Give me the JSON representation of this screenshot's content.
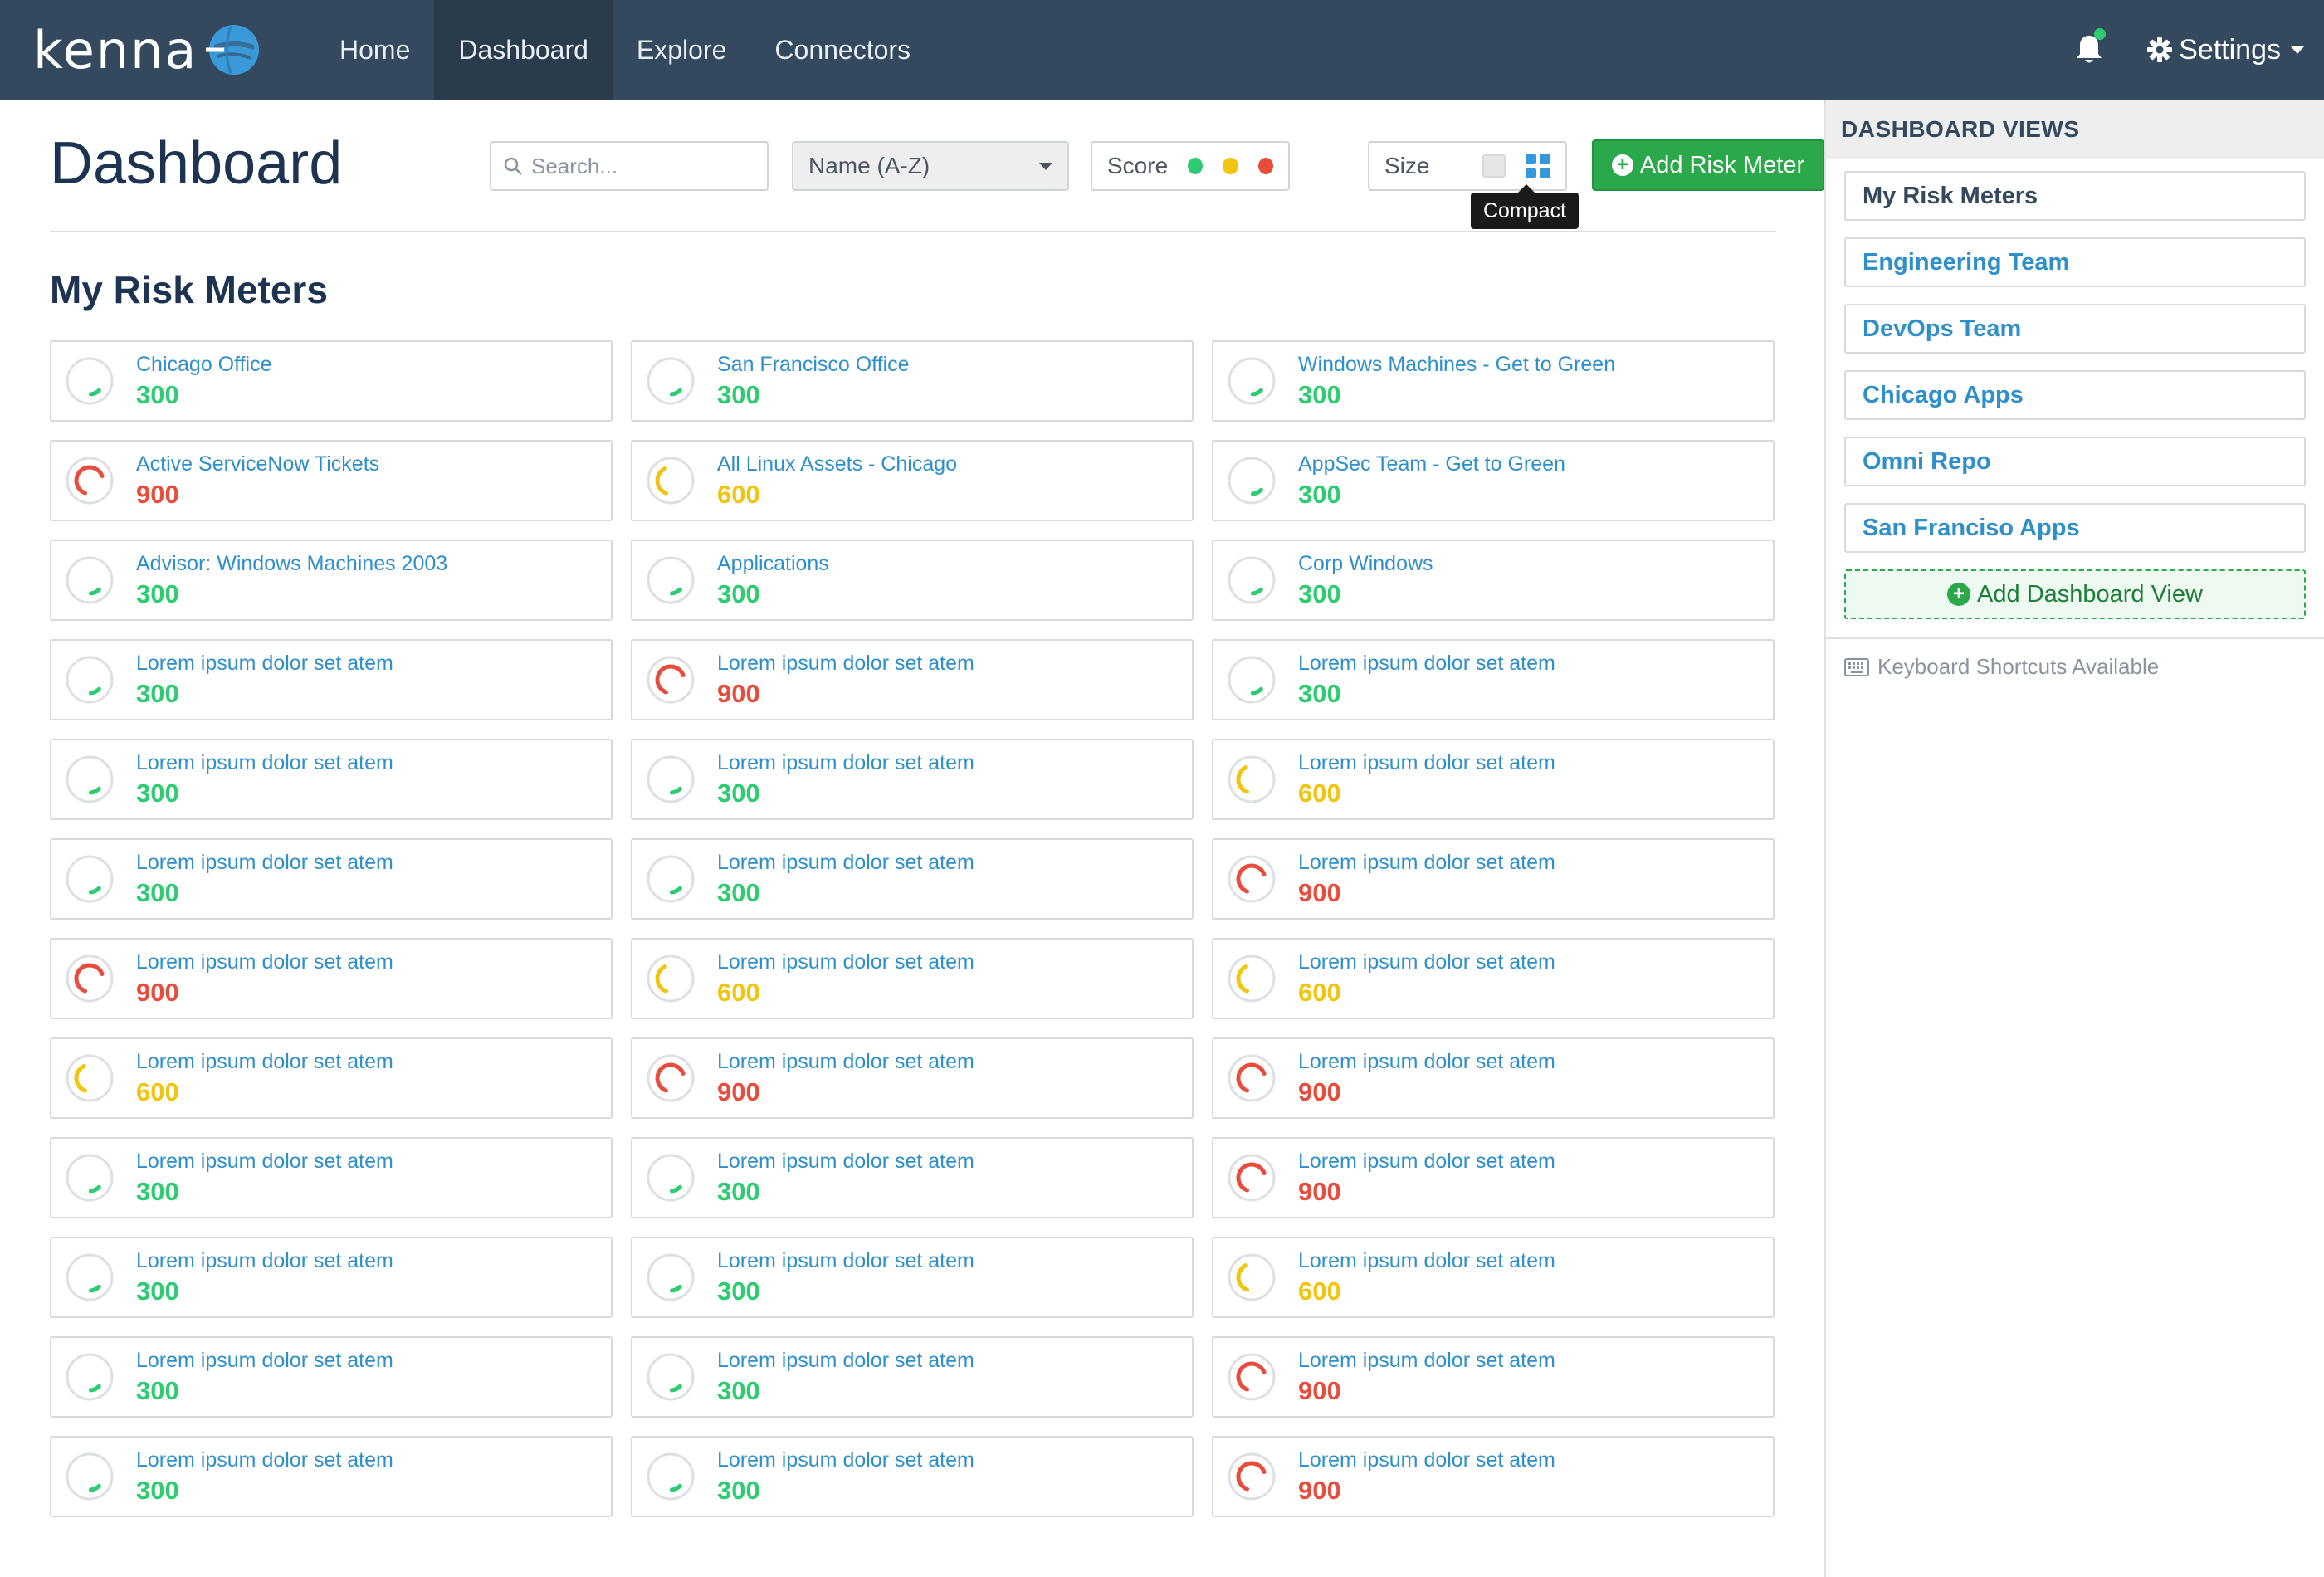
{
  "nav": {
    "logo_text": "kenna",
    "items": [
      {
        "label": "Home",
        "active": false
      },
      {
        "label": "Dashboard",
        "active": true
      },
      {
        "label": "Explore",
        "active": false
      },
      {
        "label": "Connectors",
        "active": false
      }
    ],
    "settings_label": "Settings",
    "notification_icon": "bell-icon",
    "notification_status_color": "#2ecc71"
  },
  "page": {
    "title": "Dashboard",
    "section_title": "My Risk Meters"
  },
  "toolbar": {
    "search_placeholder": "Search...",
    "sort_value": "Name (A-Z)",
    "score_label": "Score",
    "score_filters": [
      {
        "name": "low",
        "color": "#2ecc71"
      },
      {
        "name": "medium",
        "color": "#f1c40f"
      },
      {
        "name": "high",
        "color": "#e74c3c"
      }
    ],
    "size_label": "Size",
    "size_tooltip": "Compact",
    "add_button_label": "Add Risk Meter"
  },
  "colors": {
    "low": "#2ecc71",
    "medium": "#f1c40f",
    "high": "#e74c3c",
    "link": "#2e8fca",
    "nav_bg": "#34495e",
    "primary_button": "#2aa84a"
  },
  "risk_meters": [
    {
      "name": "Chicago Office",
      "score": "300",
      "level": "low"
    },
    {
      "name": "San Francisco Office",
      "score": "300",
      "level": "low"
    },
    {
      "name": "Windows Machines - Get to Green",
      "score": "300",
      "level": "low"
    },
    {
      "name": "Active ServiceNow Tickets",
      "score": "900",
      "level": "high"
    },
    {
      "name": "All Linux Assets - Chicago",
      "score": "600",
      "level": "medium"
    },
    {
      "name": "AppSec Team - Get to Green",
      "score": "300",
      "level": "low"
    },
    {
      "name": "Advisor: Windows Machines 2003",
      "score": "300",
      "level": "low"
    },
    {
      "name": "Applications",
      "score": "300",
      "level": "low"
    },
    {
      "name": "Corp Windows",
      "score": "300",
      "level": "low"
    },
    {
      "name": "Lorem ipsum dolor set atem",
      "score": "300",
      "level": "low"
    },
    {
      "name": "Lorem ipsum dolor set atem",
      "score": "900",
      "level": "high"
    },
    {
      "name": "Lorem ipsum dolor set atem",
      "score": "300",
      "level": "low"
    },
    {
      "name": "Lorem ipsum dolor set atem",
      "score": "300",
      "level": "low"
    },
    {
      "name": "Lorem ipsum dolor set atem",
      "score": "300",
      "level": "low"
    },
    {
      "name": "Lorem ipsum dolor set atem",
      "score": "600",
      "level": "medium"
    },
    {
      "name": "Lorem ipsum dolor set atem",
      "score": "300",
      "level": "low"
    },
    {
      "name": "Lorem ipsum dolor set atem",
      "score": "300",
      "level": "low"
    },
    {
      "name": "Lorem ipsum dolor set atem",
      "score": "900",
      "level": "high"
    },
    {
      "name": "Lorem ipsum dolor set atem",
      "score": "900",
      "level": "high"
    },
    {
      "name": "Lorem ipsum dolor set atem",
      "score": "600",
      "level": "medium"
    },
    {
      "name": "Lorem ipsum dolor set atem",
      "score": "600",
      "level": "medium"
    },
    {
      "name": "Lorem ipsum dolor set atem",
      "score": "600",
      "level": "medium"
    },
    {
      "name": "Lorem ipsum dolor set atem",
      "score": "900",
      "level": "high"
    },
    {
      "name": "Lorem ipsum dolor set atem",
      "score": "900",
      "level": "high"
    },
    {
      "name": "Lorem ipsum dolor set atem",
      "score": "300",
      "level": "low"
    },
    {
      "name": "Lorem ipsum dolor set atem",
      "score": "300",
      "level": "low"
    },
    {
      "name": "Lorem ipsum dolor set atem",
      "score": "900",
      "level": "high"
    },
    {
      "name": "Lorem ipsum dolor set atem",
      "score": "300",
      "level": "low"
    },
    {
      "name": "Lorem ipsum dolor set atem",
      "score": "300",
      "level": "low"
    },
    {
      "name": "Lorem ipsum dolor set atem",
      "score": "600",
      "level": "medium"
    },
    {
      "name": "Lorem ipsum dolor set atem",
      "score": "300",
      "level": "low"
    },
    {
      "name": "Lorem ipsum dolor set atem",
      "score": "300",
      "level": "low"
    },
    {
      "name": "Lorem ipsum dolor set atem",
      "score": "900",
      "level": "high"
    },
    {
      "name": "Lorem ipsum dolor set atem",
      "score": "300",
      "level": "low"
    },
    {
      "name": "Lorem ipsum dolor set atem",
      "score": "300",
      "level": "low"
    },
    {
      "name": "Lorem ipsum dolor set atem",
      "score": "900",
      "level": "high"
    }
  ],
  "sidebar": {
    "title": "DASHBOARD VIEWS",
    "views": [
      {
        "label": "My Risk Meters",
        "active": true
      },
      {
        "label": "Engineering Team",
        "active": false
      },
      {
        "label": "DevOps Team",
        "active": false
      },
      {
        "label": "Chicago Apps",
        "active": false
      },
      {
        "label": "Omni Repo",
        "active": false
      },
      {
        "label": "San Franciso Apps",
        "active": false
      }
    ],
    "add_view_label": "Add Dashboard View",
    "shortcuts_label": "Keyboard Shortcuts Available"
  }
}
